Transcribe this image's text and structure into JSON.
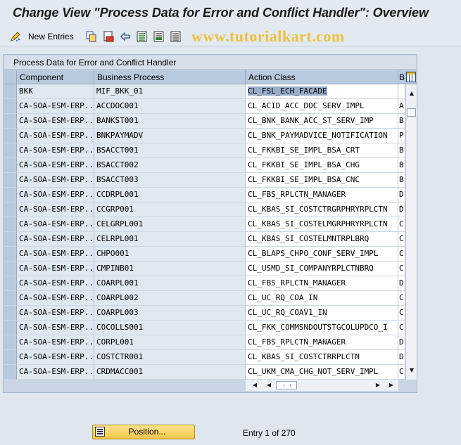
{
  "title": "Change View \"Process Data for Error and Conflict Handler\": Overview",
  "toolbar": {
    "new_entries_label": "New Entries"
  },
  "watermark": "www.tutorialkart.com",
  "panel": {
    "title": "Process Data for Error and Conflict Handler"
  },
  "table": {
    "columns": [
      "Component",
      "Business Process",
      "Action Class",
      "B"
    ],
    "rows": [
      {
        "component": "BKK",
        "process": "MIF_BKK_01",
        "action": "CL_FSL_ECH_FACADE",
        "b": ""
      },
      {
        "component": "CA-SOA-ESM-ERP...",
        "process": "ACCDOC001",
        "action": "CL_ACID_ACC_DOC_SERV_IMPL",
        "b": "A"
      },
      {
        "component": "CA-SOA-ESM-ERP...",
        "process": "BANKST001",
        "action": "CL_BNK_BANK_ACC_ST_SERV_IMP",
        "b": "B"
      },
      {
        "component": "CA-SOA-ESM-ERP...",
        "process": "BNKPAYMADV",
        "action": "CL_BNK_PAYMADVICE_NOTIFICATION",
        "b": "P"
      },
      {
        "component": "CA-SOA-ESM-ERP...",
        "process": "BSACCT001",
        "action": "CL_FKKBI_SE_IMPL_BSA_CRT",
        "b": "B"
      },
      {
        "component": "CA-SOA-ESM-ERP...",
        "process": "BSACCT002",
        "action": "CL_FKKBI_SE_IMPL_BSA_CHG",
        "b": "B"
      },
      {
        "component": "CA-SOA-ESM-ERP...",
        "process": "BSACCT003",
        "action": "CL_FKKBI_SE_IMPL_BSA_CNC",
        "b": "B"
      },
      {
        "component": "CA-SOA-ESM-ERP...",
        "process": "CCDRPL001",
        "action": "CL_FBS_RPLCTN_MANAGER",
        "b": "D"
      },
      {
        "component": "CA-SOA-ESM-ERP...",
        "process": "CCGRP001",
        "action": "CL_KBAS_SI_COSTCTRGRPHRYRPLCTN",
        "b": "D"
      },
      {
        "component": "CA-SOA-ESM-ERP...",
        "process": "CELGRPL001",
        "action": "CL_KBAS_SI_COSTELMGRPHRYRPLCTN",
        "b": "C"
      },
      {
        "component": "CA-SOA-ESM-ERP...",
        "process": "CELRPL001",
        "action": "CL_KBAS_SI_COSTELMNTRPLBRQ",
        "b": "C"
      },
      {
        "component": "CA-SOA-ESM-ERP...",
        "process": "CHPO001",
        "action": "CL_BLAPS_CHPO_CONF_SERV_IMPL",
        "b": "C"
      },
      {
        "component": "CA-SOA-ESM-ERP...",
        "process": "CMPINB01",
        "action": "CL_USMD_SI_COMPANYRPLCTNBRQ",
        "b": "C"
      },
      {
        "component": "CA-SOA-ESM-ERP...",
        "process": "COARPL001",
        "action": "CL_FBS_RPLCTN_MANAGER",
        "b": "D"
      },
      {
        "component": "CA-SOA-ESM-ERP...",
        "process": "COARPL002",
        "action": "CL_UC_RQ_COA_IN",
        "b": "C"
      },
      {
        "component": "CA-SOA-ESM-ERP...",
        "process": "COARPL003",
        "action": "CL_UC_RQ_COAV1_IN",
        "b": "C"
      },
      {
        "component": "CA-SOA-ESM-ERP...",
        "process": "COCOLLS001",
        "action": "CL_FKK_COMMSNDOUTSTGCOLUPDCO_I",
        "b": "C"
      },
      {
        "component": "CA-SOA-ESM-ERP...",
        "process": "CORPL001",
        "action": "CL_FBS_RPLCTN_MANAGER",
        "b": "D"
      },
      {
        "component": "CA-SOA-ESM-ERP...",
        "process": "COSTCTR001",
        "action": "CL_KBAS_SI_COSTCTRRPLCTN",
        "b": "D"
      },
      {
        "component": "CA-SOA-ESM-ERP...",
        "process": "CRDMACC001",
        "action": "CL_UKM_CMA_CHG_NOT_SERV_IMPL",
        "b": "C"
      }
    ]
  },
  "footer": {
    "position_label": "Position...",
    "entry_info": "Entry 1 of 270"
  }
}
